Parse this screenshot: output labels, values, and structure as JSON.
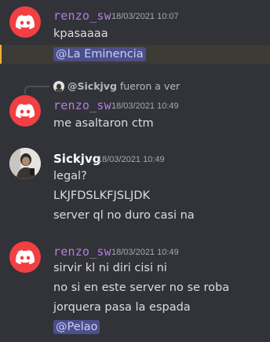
{
  "colors": {
    "background": "#313338",
    "bot_name": "#b57edc",
    "user_name": "#ffffff",
    "discord_red": "#f23f43",
    "mention_bg": "#4b4f8a",
    "mention_text": "#c9cdfb",
    "highlight_bg": "#3d3b36",
    "highlight_border": "#f0b232"
  },
  "messages": [
    {
      "author": "renzo_sw",
      "timestamp": "18/03/2021 10:07",
      "avatar_icon": "discord-icon",
      "lines": [
        "kpasaaaa",
        "@La Eminencia"
      ]
    },
    {
      "reply": {
        "author": "@Sickjvg",
        "text": "fueron a ver"
      },
      "author": "renzo_sw",
      "timestamp": "18/03/2021 10:49",
      "avatar_icon": "discord-icon",
      "lines": [
        "me asaltaron ctm"
      ]
    },
    {
      "author": "Sickjvg",
      "timestamp": "18/03/2021 10:49",
      "avatar_icon": "user-photo-avatar",
      "lines": [
        "legal?",
        "LKJFDSLKFJSLJDK",
        "server ql no duro casi na"
      ]
    },
    {
      "author": "renzo_sw",
      "timestamp": "18/03/2021 10:49",
      "avatar_icon": "discord-icon",
      "lines": [
        "sirvir kl ni diri cisi ni",
        "no si en este server no se roba",
        "jorquera pasa la espada",
        "@Pelao"
      ]
    }
  ]
}
